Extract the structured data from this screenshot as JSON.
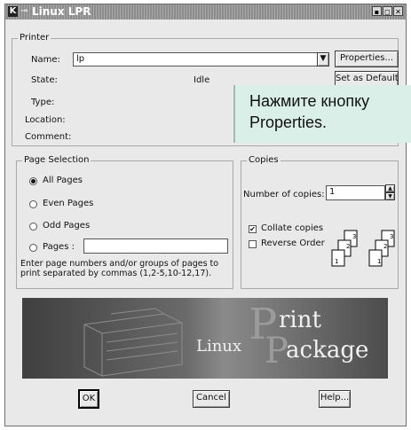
{
  "window": {
    "title": "Linux LPR",
    "title_icon": "K",
    "controls": [
      "▪",
      "◻",
      "✕"
    ]
  },
  "printer": {
    "group_title": "Printer",
    "name_label": "Name:",
    "name_value": "lp",
    "properties_button": "Properties...",
    "state_label": "State:",
    "state_value": "Idle",
    "set_default_button": "Set as Default",
    "type_label": "Type:",
    "location_label": "Location:",
    "comment_label": "Comment:"
  },
  "callout": {
    "line1": "Нажмите кнопку",
    "line2": "Properties."
  },
  "page_selection": {
    "group_title": "Page Selection",
    "options": [
      "All Pages",
      "Even Pages",
      "Odd Pages",
      "Pages :"
    ],
    "selected_index": 0,
    "pages_value": "",
    "hint": "Enter page numbers and/or groups of pages to print separated by commas (1,2-5,10-12,17)."
  },
  "copies": {
    "group_title": "Copies",
    "number_label": "Number of copies:",
    "number_value": "1",
    "collate_label": "Collate copies",
    "collate_checked": true,
    "reverse_label": "Reverse Order",
    "reverse_checked": false,
    "page_numbers": [
      "1",
      "2",
      "3"
    ]
  },
  "banner": {
    "word1": "Linux",
    "word2_initial1": "P",
    "word2_rest1": "rint",
    "word2_initial2": "P",
    "word2_rest2": "ackage"
  },
  "buttons": {
    "ok": "OK",
    "cancel": "Cancel",
    "help": "Help..."
  }
}
